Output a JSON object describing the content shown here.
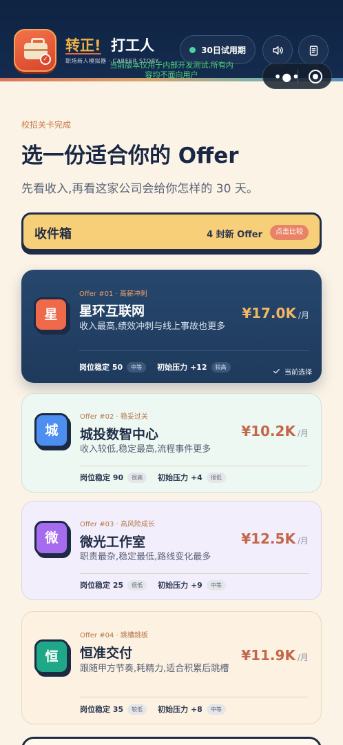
{
  "header": {
    "app_name_part1": "转正!",
    "app_name_part2": "打工人",
    "app_subtitle": "职场新人模拟器 · CAREER STORY",
    "dev_notice": "当前版本仅用于内部开发测试,所有内容均不面向用户",
    "trial_label": "30日试用期",
    "colors": {
      "background": "#0f2342",
      "trial_dot": "#4fd0a0",
      "accent_gold": "#f0b145"
    }
  },
  "intro": {
    "eyebrow": "校招关卡完成",
    "title": "选一份适合你的 Offer",
    "subtitle": "先看收入,再看这家公司会给你怎样的 30 天。"
  },
  "inbox": {
    "title": "收件箱",
    "count_label": "4 封新 Offer",
    "compare_label": "点击比较"
  },
  "offers": [
    {
      "icon_char": "星",
      "icon_color": "#ef6a4b",
      "meta": "Offer #01 · 高薪冲刺",
      "name": "星环互联网",
      "desc": "收入最高,绩效冲刺与线上事故也更多",
      "salary": "¥17.0K",
      "salary_unit": "/月",
      "stability_label": "岗位稳定 50",
      "stability_tag": "中等",
      "pressure_label": "初始压力 +12",
      "pressure_tag": "较高",
      "current_label": "当前选择"
    },
    {
      "icon_char": "城",
      "icon_color": "#4c8ff0",
      "meta": "Offer #02 · 稳妥过关",
      "name": "城投数智中心",
      "desc": "收入较低,稳定最高,流程事件更多",
      "salary": "¥10.2K",
      "salary_unit": "/月",
      "stability_label": "岗位稳定 90",
      "stability_tag": "很高",
      "pressure_label": "初始压力 +4",
      "pressure_tag": "很低"
    },
    {
      "icon_char": "微",
      "icon_color": "#a56cf0",
      "meta": "Offer #03 · 高风险成长",
      "name": "微光工作室",
      "desc": "职责最杂,稳定最低,路线变化最多",
      "salary": "¥12.5K",
      "salary_unit": "/月",
      "stability_label": "岗位稳定 25",
      "stability_tag": "很低",
      "pressure_label": "初始压力 +9",
      "pressure_tag": "中等"
    },
    {
      "icon_char": "恒",
      "icon_color": "#1fa888",
      "meta": "Offer #04 · 跳槽跳板",
      "name": "恒准交付",
      "desc": "跟随甲方节奏,耗精力,适合积累后跳槽",
      "salary": "¥11.9K",
      "salary_unit": "/月",
      "stability_label": "岗位稳定 35",
      "stability_tag": "较低",
      "pressure_label": "初始压力 +8",
      "pressure_tag": "中等"
    }
  ]
}
